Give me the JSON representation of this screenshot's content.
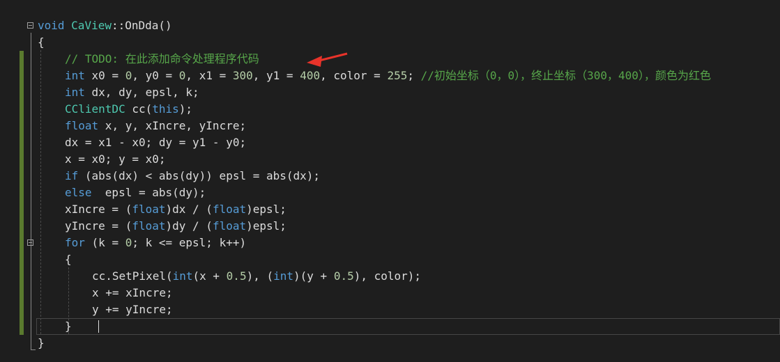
{
  "editor": {
    "lines": [
      {
        "indent": 0,
        "fold": true,
        "tokens": [
          [
            "kw",
            "void "
          ],
          [
            "cls",
            "CaView"
          ],
          [
            "pl",
            "::OnDda()"
          ]
        ]
      },
      {
        "indent": 0,
        "tokens": [
          [
            "pl",
            "{"
          ]
        ]
      },
      {
        "indent": 1,
        "tokens": [
          [
            "cm",
            "// TODO: 在此添加命令处理程序代码"
          ]
        ]
      },
      {
        "indent": 1,
        "tokens": [
          [
            "kw",
            "int"
          ],
          [
            "pl",
            " x0 = "
          ],
          [
            "num",
            "0"
          ],
          [
            "pl",
            ", y0 = "
          ],
          [
            "num",
            "0"
          ],
          [
            "pl",
            ", x1 = "
          ],
          [
            "num",
            "300"
          ],
          [
            "pl",
            ", y1 = "
          ],
          [
            "num",
            "400"
          ],
          [
            "pl",
            ", color = "
          ],
          [
            "num",
            "255"
          ],
          [
            "pl",
            "; "
          ],
          [
            "cm",
            "//初始坐标（0，0），终止坐标（300，400），颜色为红色"
          ]
        ]
      },
      {
        "indent": 1,
        "tokens": [
          [
            "kw",
            "int"
          ],
          [
            "pl",
            " dx, dy, epsl, k;"
          ]
        ]
      },
      {
        "indent": 1,
        "tokens": [
          [
            "cls",
            "CClientDC"
          ],
          [
            "pl",
            " cc("
          ],
          [
            "kw",
            "this"
          ],
          [
            "pl",
            ");"
          ]
        ]
      },
      {
        "indent": 1,
        "tokens": [
          [
            "kw",
            "float"
          ],
          [
            "pl",
            " x, y, xIncre, yIncre;"
          ]
        ]
      },
      {
        "indent": 1,
        "tokens": [
          [
            "pl",
            "dx = x1 - x0; dy = y1 - y0;"
          ]
        ]
      },
      {
        "indent": 1,
        "tokens": [
          [
            "pl",
            "x = x0; y = x0;"
          ]
        ]
      },
      {
        "indent": 1,
        "tokens": [
          [
            "kw",
            "if"
          ],
          [
            "pl",
            " (abs(dx) < abs(dy)) epsl = abs(dx);"
          ]
        ]
      },
      {
        "indent": 1,
        "tokens": [
          [
            "kw",
            "else"
          ],
          [
            "pl",
            "  epsl = abs(dy);"
          ]
        ]
      },
      {
        "indent": 1,
        "tokens": [
          [
            "pl",
            "xIncre = ("
          ],
          [
            "kw",
            "float"
          ],
          [
            "pl",
            ")dx / ("
          ],
          [
            "kw",
            "float"
          ],
          [
            "pl",
            ")epsl;"
          ]
        ]
      },
      {
        "indent": 1,
        "tokens": [
          [
            "pl",
            "yIncre = ("
          ],
          [
            "kw",
            "float"
          ],
          [
            "pl",
            ")dy / ("
          ],
          [
            "kw",
            "float"
          ],
          [
            "pl",
            ")epsl;"
          ]
        ]
      },
      {
        "indent": 1,
        "fold": true,
        "tokens": [
          [
            "kw",
            "for"
          ],
          [
            "pl",
            " (k = "
          ],
          [
            "num",
            "0"
          ],
          [
            "pl",
            "; k <= epsl; k++)"
          ]
        ]
      },
      {
        "indent": 1,
        "tokens": [
          [
            "pl",
            "{"
          ]
        ]
      },
      {
        "indent": 2,
        "tokens": [
          [
            "pl",
            "cc.SetPixel("
          ],
          [
            "kw",
            "int"
          ],
          [
            "pl",
            "(x + "
          ],
          [
            "num",
            "0.5"
          ],
          [
            "pl",
            "), ("
          ],
          [
            "kw",
            "int"
          ],
          [
            "pl",
            ")(y + "
          ],
          [
            "num",
            "0.5"
          ],
          [
            "pl",
            "), color);"
          ]
        ]
      },
      {
        "indent": 2,
        "tokens": [
          [
            "pl",
            "x += xIncre;"
          ]
        ]
      },
      {
        "indent": 2,
        "tokens": [
          [
            "pl",
            "y += yIncre;"
          ]
        ]
      },
      {
        "indent": 1,
        "current": true,
        "tokens": [
          [
            "pl",
            "}"
          ]
        ]
      },
      {
        "indent": 0,
        "tokens": [
          [
            "pl",
            "}"
          ]
        ]
      }
    ]
  },
  "annotation": {
    "arrow_color": "#e8332a"
  },
  "colors": {
    "background": "#1e1e1e",
    "keyword": "#569cd6",
    "class": "#4ec9b0",
    "number": "#b5cea8",
    "comment": "#57a64a",
    "text": "#dcdcdc",
    "change_bar": "#5a7a2e"
  }
}
